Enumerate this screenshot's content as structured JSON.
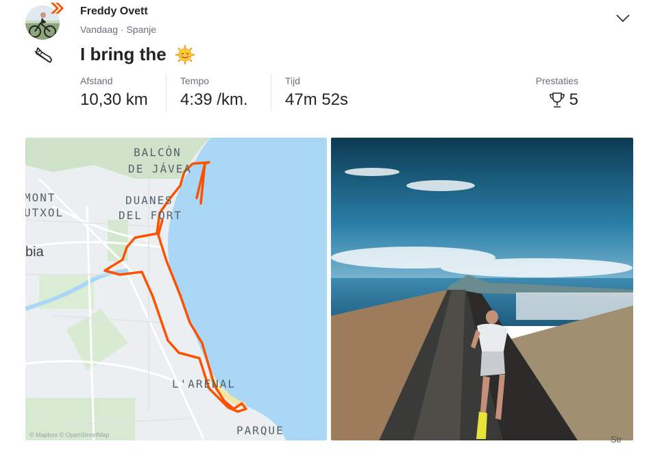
{
  "athlete": {
    "name": "Freddy Ovett",
    "meta": "Vandaag · Spanje"
  },
  "activity": {
    "title": "I bring the",
    "emoji": "smiling-sun-emoji",
    "sport_icon": "running-shoe-icon"
  },
  "stats": [
    {
      "label": "Afstand",
      "value": "10,30 km"
    },
    {
      "label": "Tempo",
      "value": "4:39 /km."
    },
    {
      "label": "Tijd",
      "value": "47m 52s"
    }
  ],
  "achievements": {
    "label": "Prestaties",
    "value": "5",
    "icon": "trophy-icon"
  },
  "map": {
    "places": [
      "BALCÓN",
      "DE JÁVEA",
      "DUANES",
      "DEL FORT",
      "MONT",
      "UTXOL",
      "bia",
      "L'ARENAL",
      "PARQUE"
    ],
    "attribution": "© Mapbox © OpenStreetMap",
    "route_color": "#fc5200"
  },
  "photo": {
    "watermark": "Str"
  },
  "colors": {
    "accent": "#fc5200",
    "text": "#242428",
    "muted": "#6d6d78"
  }
}
